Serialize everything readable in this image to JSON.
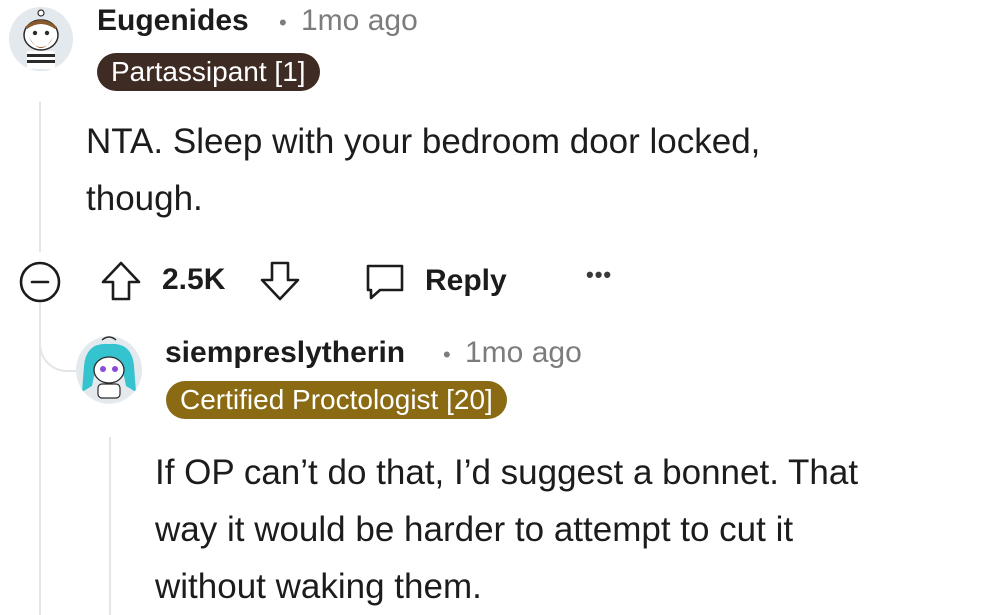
{
  "comments": [
    {
      "username": "Eugenides",
      "separator": "•",
      "time": "1mo ago",
      "flair": "Partassipant [1]",
      "flair_color": "#3d2b24",
      "body_lines": [
        "NTA. Sleep with your bedroom door locked,",
        "though."
      ],
      "score": "2.5K",
      "reply_label": "Reply",
      "more_label": "•••",
      "avatar_icon": "bearded-snoo-avatar"
    },
    {
      "username": "siempreslytherin",
      "separator": "•",
      "time": "1mo ago",
      "flair": "Certified Proctologist [20]",
      "flair_color": "#8a6a12",
      "body_lines": [
        "If OP can’t do that, I’d suggest a bonnet. That",
        "way it would be harder to attempt to cut it",
        "without waking them."
      ],
      "avatar_icon": "teal-hair-snoo-avatar"
    }
  ],
  "colors": {
    "thread_line": "#e5e5e5",
    "meta_text": "#7c7c7c"
  }
}
